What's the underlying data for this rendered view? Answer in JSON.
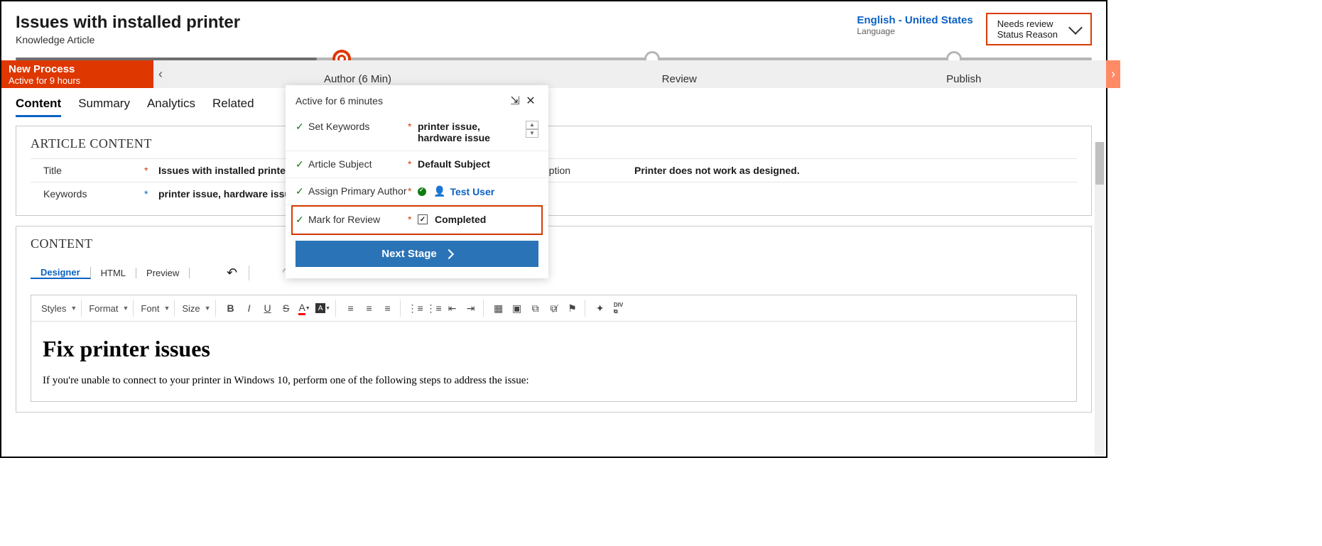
{
  "header": {
    "title": "Issues with installed printer",
    "subtitle": "Knowledge Article",
    "language": {
      "value": "English - United States",
      "label": "Language"
    },
    "status": {
      "value": "Needs review",
      "label": "Status Reason"
    }
  },
  "bpf": {
    "process_name": "New Process",
    "active_for": "Active for 9 hours",
    "stages": [
      {
        "label": "Author  (6 Min)",
        "active": true
      },
      {
        "label": "Review"
      },
      {
        "label": "Publish"
      }
    ]
  },
  "flyout": {
    "title": "Active for 6 minutes",
    "rows": [
      {
        "label": "Set Keywords",
        "value": "printer issue, hardware issue",
        "scroll": true
      },
      {
        "label": "Article Subject",
        "value": "Default Subject"
      },
      {
        "label": "Assign Primary Author",
        "value": "Test User",
        "user": true
      },
      {
        "label": "Mark for Review",
        "value": "Completed",
        "checkbox": true,
        "highlight": true
      }
    ],
    "button": "Next Stage"
  },
  "tabs": [
    "Content",
    "Summary",
    "Analytics",
    "Related"
  ],
  "article_content": {
    "section_title": "ARTICLE CONTENT",
    "title_label": "Title",
    "title_value": "Issues with installed printer",
    "keywords_label": "Keywords",
    "keywords_value": "printer issue, hardware issue",
    "description_label": "Description",
    "description_value": "Printer does not work as designed."
  },
  "content_section": {
    "section_title": "CONTENT",
    "designer_tabs": [
      "Designer",
      "HTML",
      "Preview"
    ],
    "toolbar": {
      "styles": "Styles",
      "format": "Format",
      "font": "Font",
      "size": "Size"
    },
    "body_heading": "Fix printer issues",
    "body_text": "If you're unable to connect to your printer in Windows 10, perform one of the following steps to address the issue:"
  }
}
